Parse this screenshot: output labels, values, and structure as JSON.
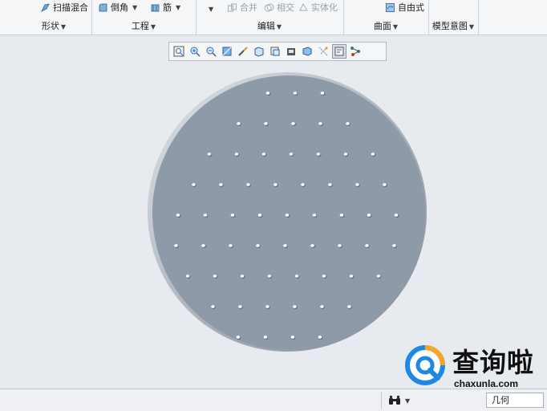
{
  "ribbon": {
    "top_items": {
      "sweep_blend": "扫描混合",
      "round": "倒角",
      "rib": "筋",
      "merge": "合并",
      "intersect": "相交",
      "solidify": "实体化",
      "freestyle": "自由式"
    },
    "groups": {
      "shape": "形状",
      "engineering": "工程",
      "editing": "编辑",
      "surfaces": "曲面",
      "model_intent": "模型意图"
    }
  },
  "view_toolbar": {
    "buttons": [
      "zoom-to-fit",
      "zoom-in",
      "zoom-out",
      "repaint",
      "spin-center",
      "display-style",
      "saved-orientations",
      "view-manager",
      "perspective",
      "datum-display",
      "annotation-display",
      "spin-center-toggle"
    ],
    "active_button": "annotation-display"
  },
  "status_bar": {
    "filter_value": "几何"
  },
  "watermark": {
    "text": "查询啦",
    "domain": "chaxunla.com"
  },
  "model": {
    "disc_color": "#8f9aa9",
    "rim_color": "#c9ced5",
    "hole_rows": [
      3,
      5,
      7,
      8,
      9,
      9,
      8,
      6,
      4
    ]
  }
}
